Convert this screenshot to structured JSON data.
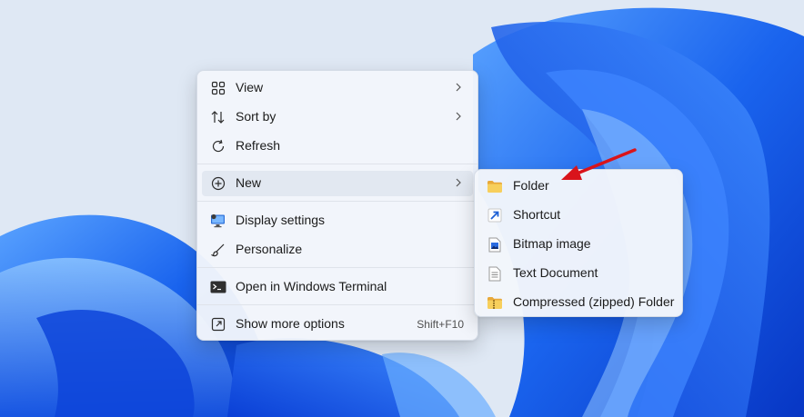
{
  "desktop": {
    "wallpaper": "windows-11-bloom",
    "colors": {
      "background": "#dde7f3",
      "bloom_dark": "#0a3fd6",
      "bloom_mid": "#1f6cf2",
      "bloom_light": "#6fb0ff"
    }
  },
  "context_menu": {
    "items": [
      {
        "label": "View",
        "icon": "grid-icon",
        "has_submenu": true
      },
      {
        "label": "Sort by",
        "icon": "sort-icon",
        "has_submenu": true
      },
      {
        "label": "Refresh",
        "icon": "refresh-icon",
        "has_submenu": false
      },
      {
        "label": "New",
        "icon": "plus-circle-icon",
        "has_submenu": true,
        "active": true
      },
      {
        "label": "Display settings",
        "icon": "display-icon",
        "has_submenu": false
      },
      {
        "label": "Personalize",
        "icon": "brush-icon",
        "has_submenu": false
      },
      {
        "label": "Open in Windows Terminal",
        "icon": "terminal-icon",
        "has_submenu": false
      },
      {
        "label": "Show more options",
        "icon": "expand-icon",
        "shortcut": "Shift+F10"
      }
    ]
  },
  "new_submenu": {
    "items": [
      {
        "label": "Folder",
        "icon": "folder-icon"
      },
      {
        "label": "Shortcut",
        "icon": "shortcut-icon"
      },
      {
        "label": "Bitmap image",
        "icon": "bitmap-icon"
      },
      {
        "label": "Text Document",
        "icon": "text-document-icon"
      },
      {
        "label": "Compressed (zipped) Folder",
        "icon": "zip-folder-icon"
      }
    ]
  },
  "annotation": {
    "type": "arrow",
    "color": "#d9141b",
    "points_to": "Folder"
  }
}
